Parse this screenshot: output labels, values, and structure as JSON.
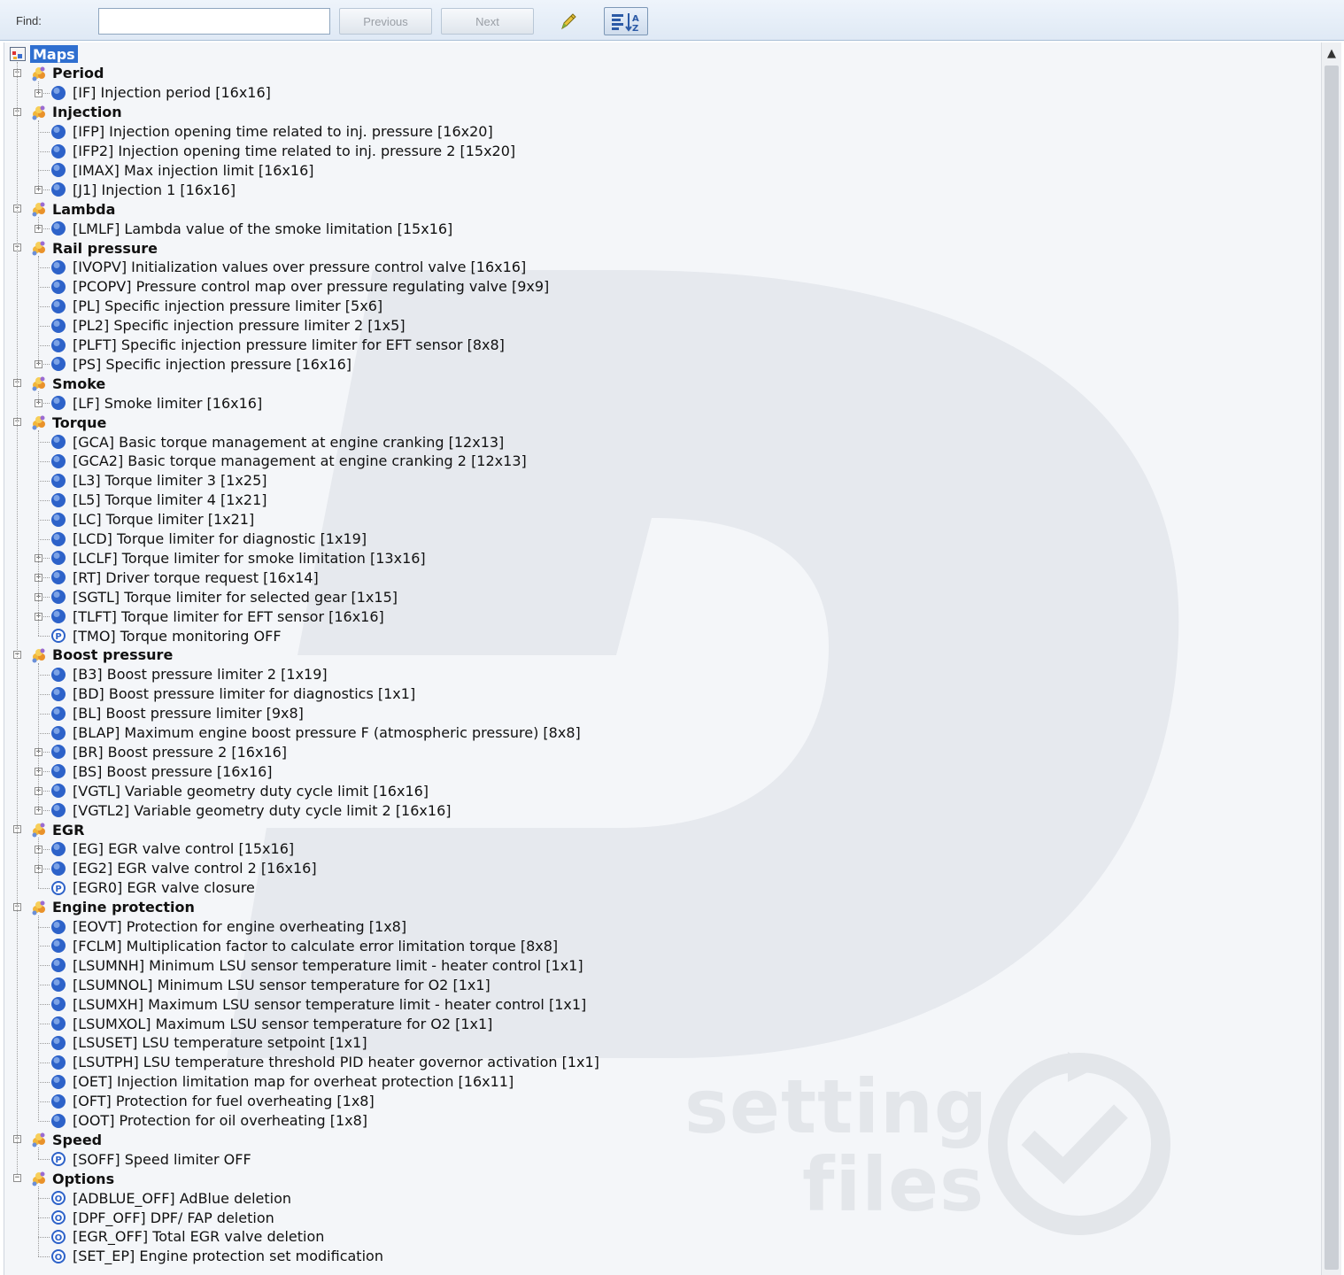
{
  "toolbar": {
    "find_label": "Find:",
    "find_value": "",
    "previous_label": "Previous",
    "next_label": "Next",
    "pencil_icon": "pencil-icon",
    "sort_icon": "sort-icon"
  },
  "tree": {
    "root_label": "Maps",
    "categories": [
      {
        "label": "Period",
        "items": [
          {
            "text": "[IF] Injection period [16x16]",
            "icon": "map",
            "expandable": true
          }
        ]
      },
      {
        "label": "Injection",
        "items": [
          {
            "text": "[IFP] Injection opening time related to inj. pressure [16x20]",
            "icon": "map",
            "expandable": false
          },
          {
            "text": "[IFP2] Injection opening time related to inj. pressure 2 [15x20]",
            "icon": "map",
            "expandable": false
          },
          {
            "text": "[IMAX] Max injection limit [16x16]",
            "icon": "map",
            "expandable": false
          },
          {
            "text": "[J1] Injection 1 [16x16]",
            "icon": "map",
            "expandable": true
          }
        ]
      },
      {
        "label": "Lambda",
        "items": [
          {
            "text": "[LMLF] Lambda value of the smoke limitation [15x16]",
            "icon": "map",
            "expandable": true
          }
        ]
      },
      {
        "label": "Rail pressure",
        "items": [
          {
            "text": "[IVOPV] Initialization values over pressure control valve [16x16]",
            "icon": "map",
            "expandable": false
          },
          {
            "text": "[PCOPV] Pressure control map over pressure regulating valve [9x9]",
            "icon": "map",
            "expandable": false
          },
          {
            "text": "[PL] Specific injection pressure limiter [5x6]",
            "icon": "map",
            "expandable": false
          },
          {
            "text": "[PL2] Specific injection pressure limiter 2 [1x5]",
            "icon": "map",
            "expandable": false
          },
          {
            "text": "[PLFT] Specific injection pressure limiter for EFT sensor [8x8]",
            "icon": "map",
            "expandable": false
          },
          {
            "text": "[PS] Specific injection pressure [16x16]",
            "icon": "map",
            "expandable": true
          }
        ]
      },
      {
        "label": "Smoke",
        "items": [
          {
            "text": "[LF] Smoke limiter [16x16]",
            "icon": "map",
            "expandable": true
          }
        ]
      },
      {
        "label": "Torque",
        "items": [
          {
            "text": "[GCA] Basic torque management at engine cranking [12x13]",
            "icon": "map",
            "expandable": false
          },
          {
            "text": "[GCA2] Basic torque management at engine cranking 2 [12x13]",
            "icon": "map",
            "expandable": false
          },
          {
            "text": "[L3] Torque limiter 3 [1x25]",
            "icon": "map",
            "expandable": false
          },
          {
            "text": "[L5] Torque limiter 4 [1x21]",
            "icon": "map",
            "expandable": false
          },
          {
            "text": "[LC] Torque limiter [1x21]",
            "icon": "map",
            "expandable": false
          },
          {
            "text": "[LCD] Torque limiter for diagnostic [1x19]",
            "icon": "map",
            "expandable": false
          },
          {
            "text": "[LCLF] Torque limiter for smoke limitation [13x16]",
            "icon": "map",
            "expandable": true
          },
          {
            "text": "[RT] Driver torque request [16x14]",
            "icon": "map",
            "expandable": true
          },
          {
            "text": "[SGTL] Torque limiter for selected gear [1x15]",
            "icon": "map",
            "expandable": true
          },
          {
            "text": "[TLFT] Torque limiter for EFT sensor [16x16]",
            "icon": "map",
            "expandable": true
          },
          {
            "text": "[TMO] Torque monitoring OFF",
            "icon": "param-p",
            "expandable": false
          }
        ]
      },
      {
        "label": "Boost pressure",
        "items": [
          {
            "text": "[B3] Boost pressure limiter 2 [1x19]",
            "icon": "map",
            "expandable": false
          },
          {
            "text": "[BD] Boost pressure limiter for diagnostics [1x1]",
            "icon": "map",
            "expandable": false
          },
          {
            "text": "[BL] Boost pressure limiter [9x8]",
            "icon": "map",
            "expandable": false
          },
          {
            "text": "[BLAP] Maximum engine boost pressure F (atmospheric pressure) [8x8]",
            "icon": "map",
            "expandable": false
          },
          {
            "text": "[BR] Boost pressure 2 [16x16]",
            "icon": "map",
            "expandable": true
          },
          {
            "text": "[BS] Boost pressure [16x16]",
            "icon": "map",
            "expandable": true
          },
          {
            "text": "[VGTL] Variable geometry duty cycle limit [16x16]",
            "icon": "map",
            "expandable": true
          },
          {
            "text": "[VGTL2] Variable geometry duty cycle limit 2 [16x16]",
            "icon": "map",
            "expandable": true
          }
        ]
      },
      {
        "label": "EGR",
        "items": [
          {
            "text": "[EG] EGR valve control [15x16]",
            "icon": "map",
            "expandable": true
          },
          {
            "text": "[EG2] EGR valve control 2 [16x16]",
            "icon": "map",
            "expandable": true
          },
          {
            "text": "[EGR0] EGR valve closure",
            "icon": "param-p",
            "expandable": false
          }
        ]
      },
      {
        "label": "Engine protection",
        "items": [
          {
            "text": "[EOVT] Protection for engine overheating [1x8]",
            "icon": "map",
            "expandable": false
          },
          {
            "text": "[FCLM] Multiplication factor to calculate error limitation torque [8x8]",
            "icon": "map",
            "expandable": false
          },
          {
            "text": "[LSUMNH] Minimum LSU sensor temperature limit - heater control [1x1]",
            "icon": "map",
            "expandable": false
          },
          {
            "text": "[LSUMNOL] Minimum LSU sensor temperature for O2 [1x1]",
            "icon": "map",
            "expandable": false
          },
          {
            "text": "[LSUMXH] Maximum LSU sensor temperature limit - heater control [1x1]",
            "icon": "map",
            "expandable": false
          },
          {
            "text": "[LSUMXOL] Maximum LSU sensor temperature for O2 [1x1]",
            "icon": "map",
            "expandable": false
          },
          {
            "text": "[LSUSET] LSU temperature setpoint [1x1]",
            "icon": "map",
            "expandable": false
          },
          {
            "text": "[LSUTPH] LSU temperature threshold PID heater governor activation [1x1]",
            "icon": "map",
            "expandable": false
          },
          {
            "text": "[OET] Injection limitation map for overheat protection [16x11]",
            "icon": "map",
            "expandable": false
          },
          {
            "text": "[OFT] Protection for fuel overheating [1x8]",
            "icon": "map",
            "expandable": false
          },
          {
            "text": "[OOT] Protection for oil overheating [1x8]",
            "icon": "map",
            "expandable": false
          }
        ]
      },
      {
        "label": "Speed",
        "items": [
          {
            "text": "[SOFF] Speed limiter OFF",
            "icon": "param-p",
            "expandable": false
          }
        ]
      },
      {
        "label": "Options",
        "items": [
          {
            "text": "[ADBLUE_OFF] AdBlue deletion",
            "icon": "option-o",
            "expandable": false
          },
          {
            "text": "[DPF_OFF] DPF/ FAP deletion",
            "icon": "option-o",
            "expandable": false
          },
          {
            "text": "[EGR_OFF] Total EGR valve deletion",
            "icon": "option-o",
            "expandable": false
          },
          {
            "text": "[SET_EP] Engine protection set modification",
            "icon": "option-o",
            "expandable": false
          }
        ]
      }
    ]
  },
  "watermark": {
    "line1": "setting",
    "line2": "files"
  },
  "colors": {
    "selection": "#2f6fd0",
    "map_icon": "#2d62c9",
    "watermark": "#e3e6ea"
  }
}
